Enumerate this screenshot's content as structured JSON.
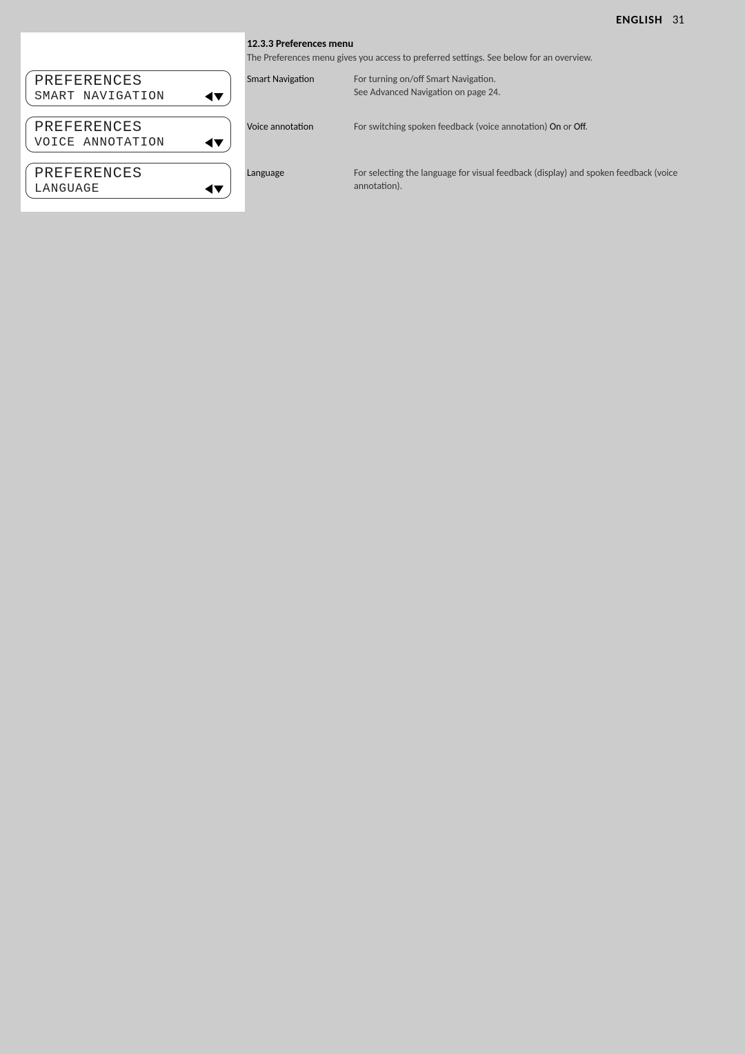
{
  "header": {
    "lang": "ENGLISH",
    "page": "31"
  },
  "section": {
    "number_title": "12.3.3 Preferences menu",
    "intro": "The Preferences menu gives you access to preferred settings. See below for an overview."
  },
  "lcd": {
    "title": "PREFERENCES",
    "items": [
      {
        "value": "SMART NAVIGATION"
      },
      {
        "value": "VOICE ANNOTATION"
      },
      {
        "value": "LANGUAGE"
      }
    ]
  },
  "definitions": [
    {
      "term": "Smart Navigation",
      "line1": "For turning on/off Smart Navigation.",
      "line2": "See Advanced Navigation on page 24."
    },
    {
      "term": "Voice annotation",
      "line1_pre": "For switching spoken feedback (voice annotation) ",
      "on": "On",
      "mid": " or ",
      "off": "Off",
      "post": "."
    },
    {
      "term": "Language",
      "line1": "For selecting the language for visual feedback (display) and spoken feedback (voice annotation)."
    }
  ]
}
